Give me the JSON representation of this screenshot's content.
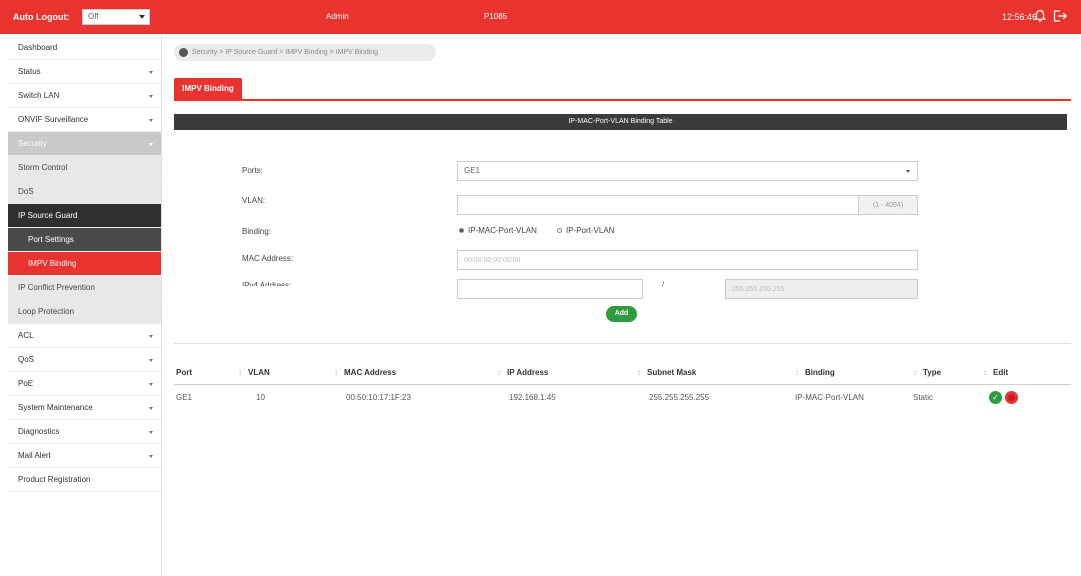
{
  "topbar": {
    "logout_label": "Auto Logout:",
    "logout_value": "Off",
    "user": "Admin",
    "model": "P1085",
    "clock": "12:56:46"
  },
  "sidebar": {
    "items": [
      {
        "label": "Dashboard"
      },
      {
        "label": "Status"
      },
      {
        "label": "Switch LAN"
      },
      {
        "label": "ONVIF Surveillance"
      },
      {
        "label": "Security"
      },
      {
        "label": "Storm Control"
      },
      {
        "label": "DoS"
      },
      {
        "label": "IP Source Guard"
      },
      {
        "label": "Port Settings"
      },
      {
        "label": "IMPV Binding"
      },
      {
        "label": "IP Conflict Prevention"
      },
      {
        "label": "Loop Protection"
      },
      {
        "label": "ACL"
      },
      {
        "label": "QoS"
      },
      {
        "label": "PoE"
      },
      {
        "label": "System Maintenance"
      },
      {
        "label": "Diagnostics"
      },
      {
        "label": "Mail Alert"
      },
      {
        "label": "Product Registration"
      }
    ]
  },
  "breadcrumb": "Security > IP Source Guard > IMPV Binding > IMPV Binding",
  "tab": "IMPV Binding",
  "panel_title": "IP-MAC-Port-VLAN Binding Table",
  "form": {
    "ports_label": "Ports:",
    "ports_value": "GE1",
    "vlan_label": "VLAN:",
    "vlan_value": "",
    "vlan_range": "(1 - 4094)",
    "binding_label": "Binding:",
    "binding_opt1": "IP-MAC-Port-VLAN",
    "binding_opt2": "IP-Port-VLAN",
    "mac_label": "MAC Address:",
    "mac_placeholder": "00:00:00:00:00:00",
    "ip_label": "IPv4 Address:",
    "ip_value": "",
    "mask_placeholder": "255.255.255.255",
    "add_label": "Add"
  },
  "table": {
    "headers": [
      "Port",
      "VLAN",
      "MAC Address",
      "IP Address",
      "Subnet Mask",
      "Binding",
      "Type",
      "Edit"
    ],
    "rows": [
      [
        "GE1",
        "10",
        "00:50:10:17:1F:23",
        "192.168.1.45",
        "255.255.255.255",
        "IP-MAC-Port-VLAN",
        "Static"
      ]
    ]
  },
  "colors": {
    "accent": "#e8332f",
    "dark": "#3b3b3b",
    "ok": "#2e9b3f"
  },
  "icons": {
    "bell": "bell-icon",
    "logout": "logout-icon",
    "home": "home-icon",
    "edit": "check-icon",
    "delete": "delete-icon"
  }
}
